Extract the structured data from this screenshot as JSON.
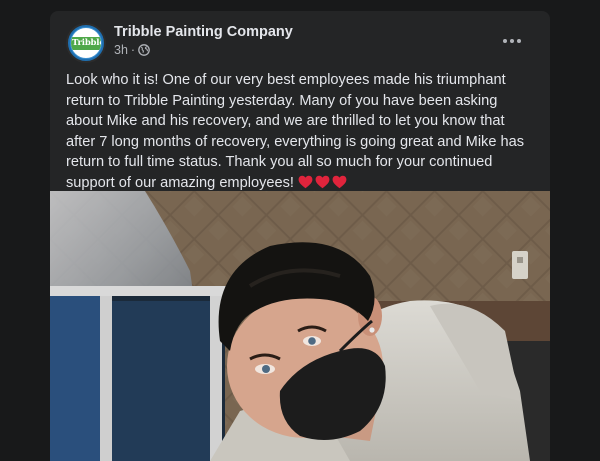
{
  "post": {
    "page_name": "Tribble Painting Company",
    "avatar_text": "Tribble",
    "time": "3h",
    "separator": "·",
    "text": "Look who it is! One of our very best employees made his triumphant\nreturn to Tribble Painting yesterday. Many of you have been asking\nabout Mike and his recovery, and we are thrilled to let you know that\nafter 7 long months of recovery, everything is going great and Mike has\nreturn to full time status. Thank you all so much for your continued\nsupport of our amazing employees! ",
    "emoji": [
      "red-heart-icon",
      "red-heart-icon",
      "red-heart-icon"
    ]
  },
  "icons": {
    "privacy": "globe-icon",
    "options": "more-options-icon"
  },
  "colors": {
    "background": "#18191a",
    "card": "#242526",
    "primary_text": "#e4e6eb",
    "secondary_text": "#b0b3b8",
    "heart": "#e0243c"
  }
}
